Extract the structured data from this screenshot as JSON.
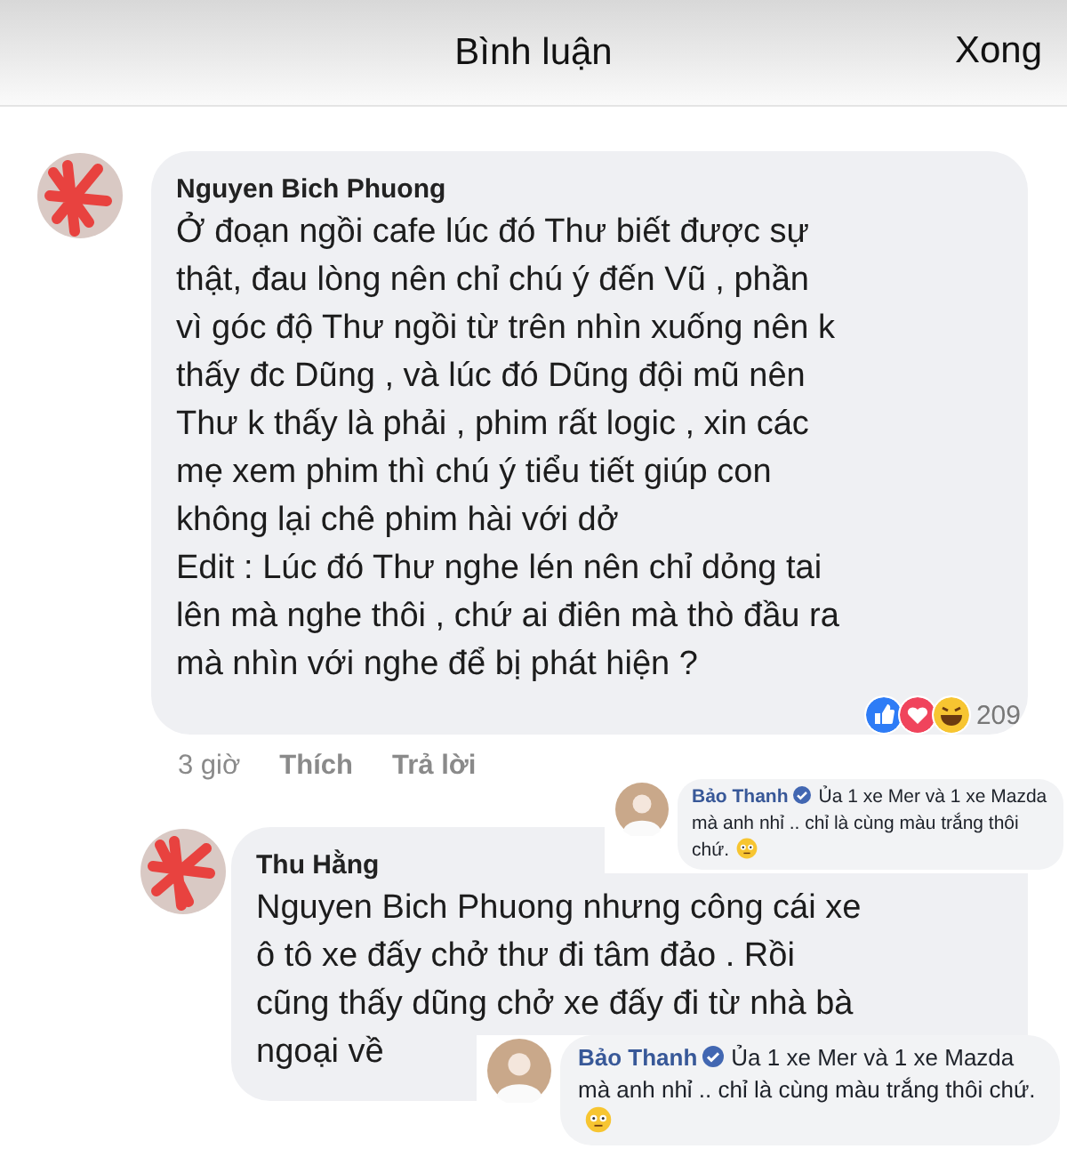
{
  "header": {
    "title": "Bình luận",
    "done": "Xong"
  },
  "comments": [
    {
      "author": "Nguyen Bich Phuong",
      "lines": [
        "Ở đoạn ngồi cafe lúc đó Thư biết được sự",
        "thật, đau lòng nên chỉ chú ý đến Vũ , phần",
        "vì góc độ Thư ngồi từ trên nhìn xuống nên k",
        "thấy đc Dũng , và lúc đó Dũng đội mũ nên",
        "Thư k thấy là phải , phim rất logic , xin các",
        "mẹ xem phim thì chú ý tiểu tiết giúp con",
        "không lại chê phim hài với dở",
        "Edit : Lúc đó Thư nghe lén nên chỉ dỏng tai",
        "lên mà nghe thôi , chứ ai điên mà thò đầu ra",
        "mà nhìn với nghe để bị phát hiện ?"
      ],
      "reaction_count": "209",
      "time": "3 giờ",
      "like": "Thích",
      "reply": "Trả lời"
    },
    {
      "author": "Thu Hằng",
      "lines": [
        "Nguyen Bich Phuong nhưng công cái xe",
        "ô tô xe đấy chở thư đi tâm đảo . Rồi",
        "cũng thấy dũng chở xe đấy đi từ nhà bà",
        "ngoại về"
      ]
    }
  ],
  "overlays": [
    {
      "author": "Bảo Thanh",
      "text": "Ủa 1 xe Mer và 1 xe Mazda mà anh nhỉ .. chỉ là cùng màu trắng thôi chứ."
    },
    {
      "author": "Bảo Thanh",
      "text": "Ủa 1 xe Mer và 1 xe Mazda mà anh nhỉ .. chỉ là cùng màu trắng thôi chứ."
    }
  ]
}
